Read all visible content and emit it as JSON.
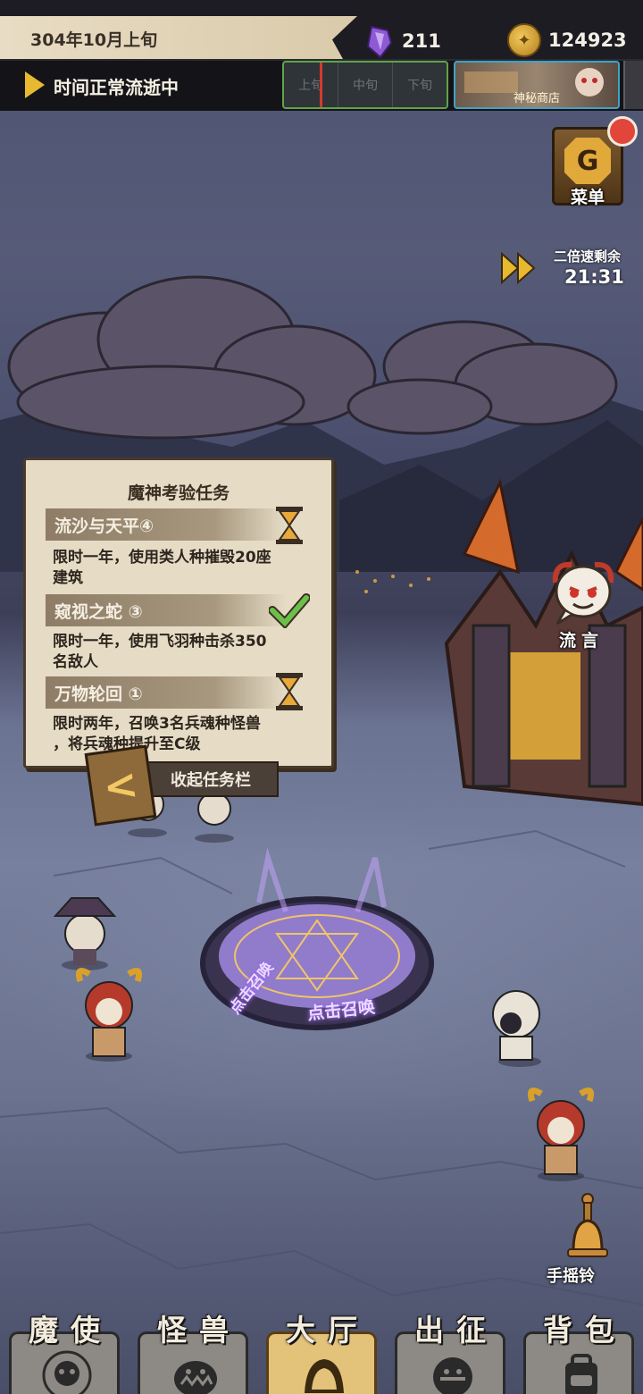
{
  "header": {
    "date": "304年10月上旬",
    "gems": "211",
    "coins": "124923",
    "time_status": "时间正常流逝中",
    "periods": [
      "上旬",
      "中旬",
      "下旬"
    ],
    "shop_label": "神秘商店"
  },
  "controls": {
    "menu_label": "菜单",
    "speed_label": "二倍速剩余",
    "speed_time": "21:31",
    "rumor_label": "流言",
    "bell_label": "手摇铃"
  },
  "quest_panel": {
    "title": "魔神考验任务",
    "quests": [
      {
        "name": "流沙与天平④",
        "desc_lines": [
          "限时一年，使用类人种摧毁20座",
          "建筑"
        ],
        "status": "in-progress"
      },
      {
        "name": "窥视之蛇 ③",
        "desc_lines": [
          "限时一年，使用飞羽种击杀350",
          "名敌人"
        ],
        "status": "complete"
      },
      {
        "name": "万物轮回 ①",
        "desc_lines": [
          "限时两年，召唤3名兵魂种怪兽",
          "，将兵魂种提升至C级"
        ],
        "status": "in-progress"
      }
    ],
    "collapse_label": "收起任务栏"
  },
  "summon": {
    "text_left": "点击召唤",
    "text_center": "点击召唤"
  },
  "bottom_nav": [
    {
      "label": "魔使",
      "icon": "skull-icon",
      "active": false
    },
    {
      "label": "怪兽",
      "icon": "monster-icon",
      "active": false
    },
    {
      "label": "大厅",
      "icon": "hall-icon",
      "active": true
    },
    {
      "label": "出征",
      "icon": "expedition-icon",
      "active": false
    },
    {
      "label": "背包",
      "icon": "backpack-icon",
      "active": false
    }
  ]
}
